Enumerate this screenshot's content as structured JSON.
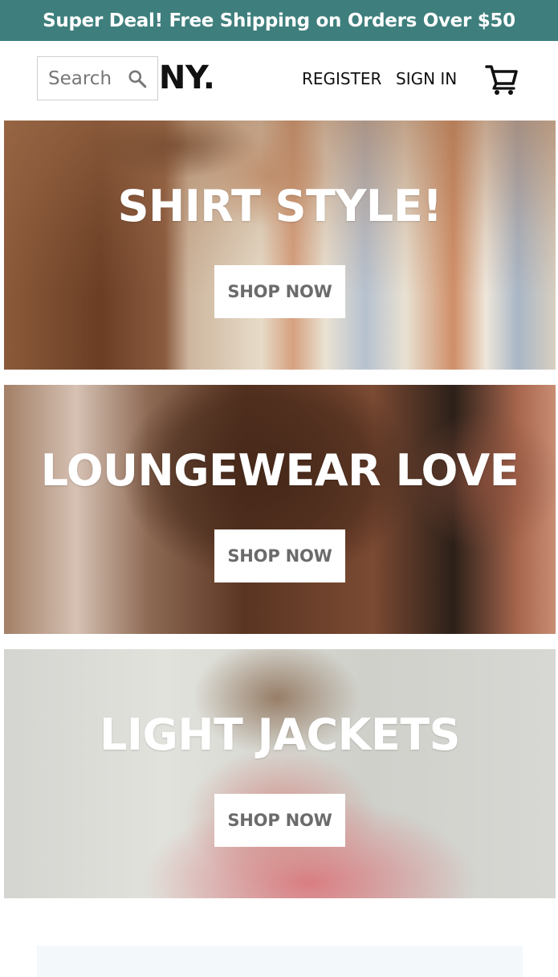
{
  "promo": {
    "text": "Super Deal! Free Shipping on Orders Over $50"
  },
  "header": {
    "logo_text": "IONY.",
    "search_placeholder": "Search",
    "register_label": "REGISTER",
    "signin_label": "SIGN IN"
  },
  "banners": [
    {
      "title": "SHIRT STYLE!",
      "button_label": "SHOP NOW"
    },
    {
      "title": "LOUNGEWEAR LOVE",
      "button_label": "SHOP NOW"
    },
    {
      "title": "LIGHT JACKETS",
      "button_label": "SHOP NOW"
    }
  ],
  "icons": {
    "search": "search-icon",
    "cart": "shopping-cart-icon"
  },
  "colors": {
    "promo_bg": "#3e7f7d",
    "promo_text": "#ffffff",
    "text_dark": "#111111",
    "button_text": "#6b6b6b",
    "footer_strip": "#f3f8fb"
  }
}
